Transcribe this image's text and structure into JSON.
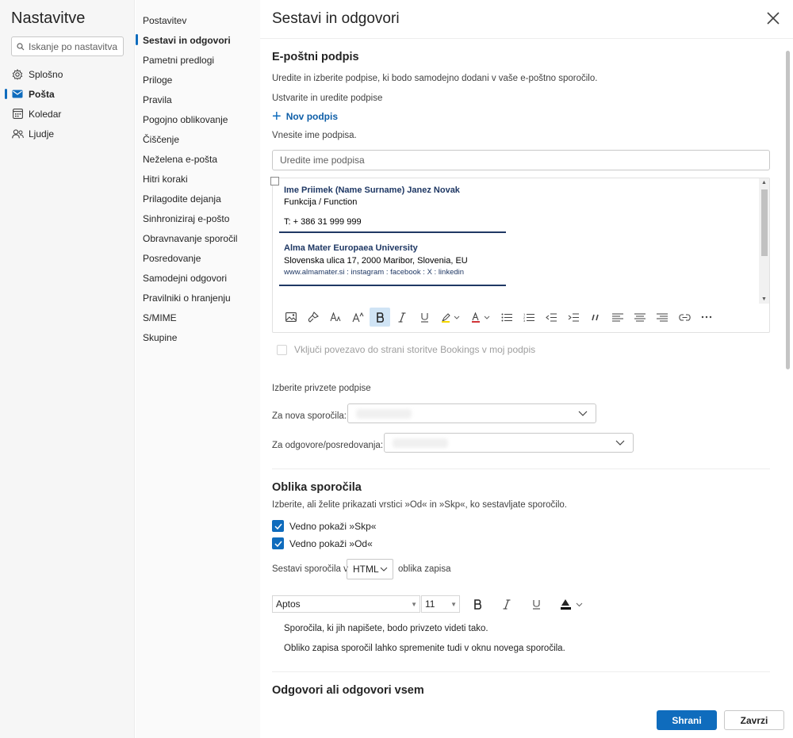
{
  "left_nav": {
    "title": "Nastavitve",
    "search_placeholder": "Iskanje po nastavitvah",
    "items": [
      {
        "label": "Splošno",
        "icon": "gear-icon"
      },
      {
        "label": "Pošta",
        "icon": "mail-icon",
        "active": true
      },
      {
        "label": "Koledar",
        "icon": "calendar-icon"
      },
      {
        "label": "Ljudje",
        "icon": "people-icon"
      }
    ]
  },
  "sub_nav": {
    "items": [
      "Postavitev",
      "Sestavi in odgovori",
      "Pametni predlogi",
      "Priloge",
      "Pravila",
      "Pogojno oblikovanje",
      "Čiščenje",
      "Neželena e-pošta",
      "Hitri koraki",
      "Prilagodite dejanja",
      "Sinhroniziraj e-pošto",
      "Obravnavanje sporočil",
      "Posredovanje",
      "Samodejni odgovori",
      "Pravilniki o hranjenju",
      "S/MIME",
      "Skupine"
    ],
    "active_index": 1
  },
  "main": {
    "title": "Sestavi in odgovori",
    "signature": {
      "heading": "E-poštni podpis",
      "description": "Uredite in izberite podpise, ki bodo samodejno dodani v vaše e-poštno sporočilo.",
      "create_label": "Ustvarite in uredite podpise",
      "new_signature": "Nov podpis",
      "name_prompt": "Vnesite ime podpisa.",
      "name_placeholder": "Uredite ime podpisa",
      "content": {
        "name_line": "Ime Priimek (Name Surname) Janez Novak",
        "function": "Funkcija / Function",
        "phone": "T: + 386 31 999 999",
        "org": "Alma Mater Europaea University",
        "address": "Slovenska ulica 17, 2000 Maribor, Slovenia, EU",
        "links": "www.almamater.si : instagram : facebook : X : linkedin"
      },
      "bookings_label": "Vključi povezavo do strani storitve Bookings v moj podpis",
      "defaults_heading": "Izberite privzete podpise",
      "new_messages_label": "Za nova sporočila:",
      "replies_label": "Za odgovore/posredovanja:"
    },
    "message_format": {
      "heading": "Oblika sporočila",
      "description": "Izberite, ali želite prikazati vrstici »Od« in »Skp«, ko sestavljate sporočilo.",
      "show_bcc": "Vedno pokaži »Skp«",
      "show_from": "Vedno pokaži »Od«",
      "compose_prefix": "Sestavi sporočila v",
      "format_value": "HTML",
      "compose_suffix": "oblika zapisa",
      "font_name": "Aptos",
      "font_size": "11",
      "preview_line1": "Sporočila, ki jih napišete, bodo privzeto videti tako.",
      "preview_line2": "Obliko zapisa sporočil lahko spremenite tudi v oknu novega sporočila."
    },
    "replies": {
      "heading": "Odgovori ali odgovori vsem"
    },
    "buttons": {
      "save": "Shrani",
      "discard": "Zavrzi"
    }
  },
  "colors": {
    "accent": "#0f6cbd",
    "signature_text": "#1f3864"
  }
}
